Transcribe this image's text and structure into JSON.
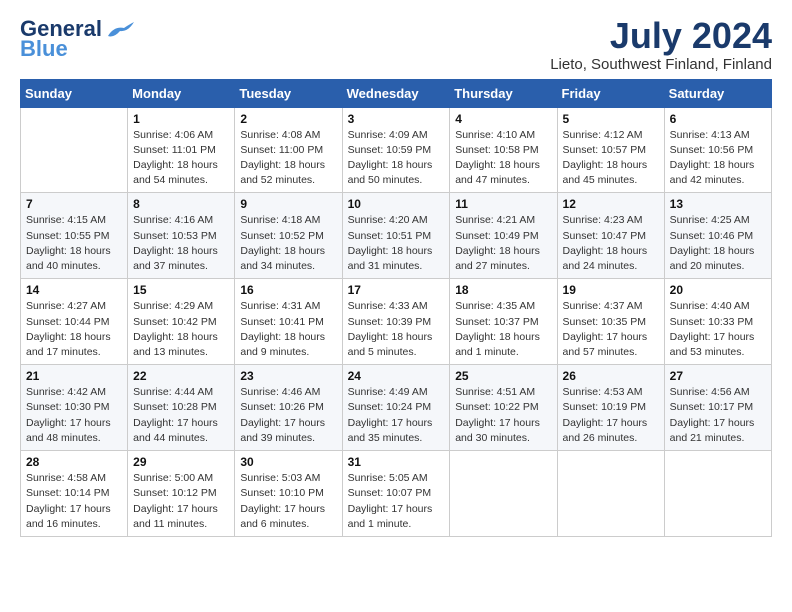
{
  "header": {
    "logo_line1": "General",
    "logo_line2": "Blue",
    "month_title": "July 2024",
    "location": "Lieto, Southwest Finland, Finland"
  },
  "weekdays": [
    "Sunday",
    "Monday",
    "Tuesday",
    "Wednesday",
    "Thursday",
    "Friday",
    "Saturday"
  ],
  "weeks": [
    [
      {
        "day": "",
        "info": ""
      },
      {
        "day": "1",
        "info": "Sunrise: 4:06 AM\nSunset: 11:01 PM\nDaylight: 18 hours\nand 54 minutes."
      },
      {
        "day": "2",
        "info": "Sunrise: 4:08 AM\nSunset: 11:00 PM\nDaylight: 18 hours\nand 52 minutes."
      },
      {
        "day": "3",
        "info": "Sunrise: 4:09 AM\nSunset: 10:59 PM\nDaylight: 18 hours\nand 50 minutes."
      },
      {
        "day": "4",
        "info": "Sunrise: 4:10 AM\nSunset: 10:58 PM\nDaylight: 18 hours\nand 47 minutes."
      },
      {
        "day": "5",
        "info": "Sunrise: 4:12 AM\nSunset: 10:57 PM\nDaylight: 18 hours\nand 45 minutes."
      },
      {
        "day": "6",
        "info": "Sunrise: 4:13 AM\nSunset: 10:56 PM\nDaylight: 18 hours\nand 42 minutes."
      }
    ],
    [
      {
        "day": "7",
        "info": "Sunrise: 4:15 AM\nSunset: 10:55 PM\nDaylight: 18 hours\nand 40 minutes."
      },
      {
        "day": "8",
        "info": "Sunrise: 4:16 AM\nSunset: 10:53 PM\nDaylight: 18 hours\nand 37 minutes."
      },
      {
        "day": "9",
        "info": "Sunrise: 4:18 AM\nSunset: 10:52 PM\nDaylight: 18 hours\nand 34 minutes."
      },
      {
        "day": "10",
        "info": "Sunrise: 4:20 AM\nSunset: 10:51 PM\nDaylight: 18 hours\nand 31 minutes."
      },
      {
        "day": "11",
        "info": "Sunrise: 4:21 AM\nSunset: 10:49 PM\nDaylight: 18 hours\nand 27 minutes."
      },
      {
        "day": "12",
        "info": "Sunrise: 4:23 AM\nSunset: 10:47 PM\nDaylight: 18 hours\nand 24 minutes."
      },
      {
        "day": "13",
        "info": "Sunrise: 4:25 AM\nSunset: 10:46 PM\nDaylight: 18 hours\nand 20 minutes."
      }
    ],
    [
      {
        "day": "14",
        "info": "Sunrise: 4:27 AM\nSunset: 10:44 PM\nDaylight: 18 hours\nand 17 minutes."
      },
      {
        "day": "15",
        "info": "Sunrise: 4:29 AM\nSunset: 10:42 PM\nDaylight: 18 hours\nand 13 minutes."
      },
      {
        "day": "16",
        "info": "Sunrise: 4:31 AM\nSunset: 10:41 PM\nDaylight: 18 hours\nand 9 minutes."
      },
      {
        "day": "17",
        "info": "Sunrise: 4:33 AM\nSunset: 10:39 PM\nDaylight: 18 hours\nand 5 minutes."
      },
      {
        "day": "18",
        "info": "Sunrise: 4:35 AM\nSunset: 10:37 PM\nDaylight: 18 hours\nand 1 minute."
      },
      {
        "day": "19",
        "info": "Sunrise: 4:37 AM\nSunset: 10:35 PM\nDaylight: 17 hours\nand 57 minutes."
      },
      {
        "day": "20",
        "info": "Sunrise: 4:40 AM\nSunset: 10:33 PM\nDaylight: 17 hours\nand 53 minutes."
      }
    ],
    [
      {
        "day": "21",
        "info": "Sunrise: 4:42 AM\nSunset: 10:30 PM\nDaylight: 17 hours\nand 48 minutes."
      },
      {
        "day": "22",
        "info": "Sunrise: 4:44 AM\nSunset: 10:28 PM\nDaylight: 17 hours\nand 44 minutes."
      },
      {
        "day": "23",
        "info": "Sunrise: 4:46 AM\nSunset: 10:26 PM\nDaylight: 17 hours\nand 39 minutes."
      },
      {
        "day": "24",
        "info": "Sunrise: 4:49 AM\nSunset: 10:24 PM\nDaylight: 17 hours\nand 35 minutes."
      },
      {
        "day": "25",
        "info": "Sunrise: 4:51 AM\nSunset: 10:22 PM\nDaylight: 17 hours\nand 30 minutes."
      },
      {
        "day": "26",
        "info": "Sunrise: 4:53 AM\nSunset: 10:19 PM\nDaylight: 17 hours\nand 26 minutes."
      },
      {
        "day": "27",
        "info": "Sunrise: 4:56 AM\nSunset: 10:17 PM\nDaylight: 17 hours\nand 21 minutes."
      }
    ],
    [
      {
        "day": "28",
        "info": "Sunrise: 4:58 AM\nSunset: 10:14 PM\nDaylight: 17 hours\nand 16 minutes."
      },
      {
        "day": "29",
        "info": "Sunrise: 5:00 AM\nSunset: 10:12 PM\nDaylight: 17 hours\nand 11 minutes."
      },
      {
        "day": "30",
        "info": "Sunrise: 5:03 AM\nSunset: 10:10 PM\nDaylight: 17 hours\nand 6 minutes."
      },
      {
        "day": "31",
        "info": "Sunrise: 5:05 AM\nSunset: 10:07 PM\nDaylight: 17 hours\nand 1 minute."
      },
      {
        "day": "",
        "info": ""
      },
      {
        "day": "",
        "info": ""
      },
      {
        "day": "",
        "info": ""
      }
    ]
  ]
}
